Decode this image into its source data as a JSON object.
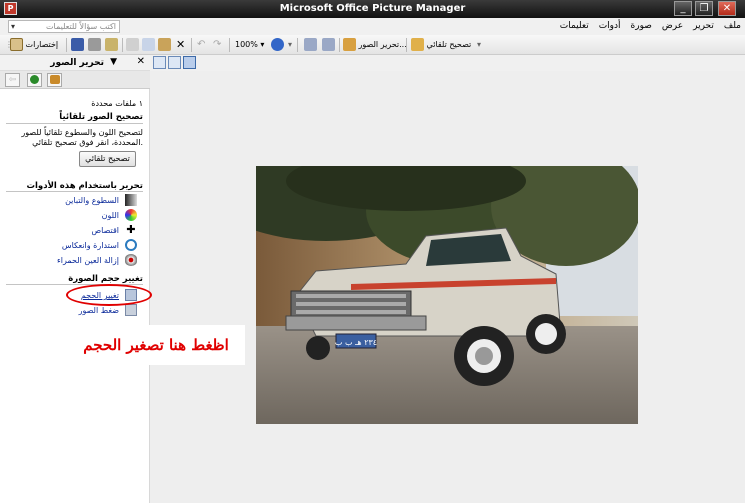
{
  "window": {
    "title": "Microsoft Office Picture Manager",
    "app_icon_label": "P",
    "minimize": "_",
    "restore": "❐",
    "close": "✕"
  },
  "menu": {
    "items": [
      "ملف",
      "تحرير",
      "عرض",
      "صورة",
      "أدوات",
      "تعليمات"
    ],
    "help_placeholder": "اكتب سؤالاً للتعليمات"
  },
  "toolbar": {
    "auto_correct": "تصحيح تلقائي",
    "edit_pictures": "تحرير الصور...",
    "zoom": "100%",
    "shortcuts": "إختصارات"
  },
  "pane": {
    "title": "تحرير الصور",
    "selected_files": "١ ملفات محددة",
    "auto_section": "تصحيح الصور تلقائياً",
    "auto_desc_1": "لتصحيح اللون والسطوع تلقائياً للصور",
    "auto_desc_2": "المحددة، انقر فوق تصحيح تلقائي.",
    "auto_button": "تصحيح تلقائي",
    "tools_section": "تحرير باستخدام هذه الأدوات",
    "tools": [
      {
        "label": "السطوع والتباين"
      },
      {
        "label": "اللون"
      },
      {
        "label": "اقتصاص"
      },
      {
        "label": "استدارة وانعكاس"
      },
      {
        "label": "إزالة العين الحمراء"
      }
    ],
    "resize_section": "تغيير حجم الصورة",
    "resize_links": [
      {
        "label": "تغيير الحجم"
      },
      {
        "label": "ضغط الصور"
      }
    ]
  },
  "annotation": {
    "text": "اظغط هنا تصغير الحجم",
    "color": "#e00000"
  },
  "photo": {
    "plate": "٢٣٤ هـ ب ب"
  }
}
